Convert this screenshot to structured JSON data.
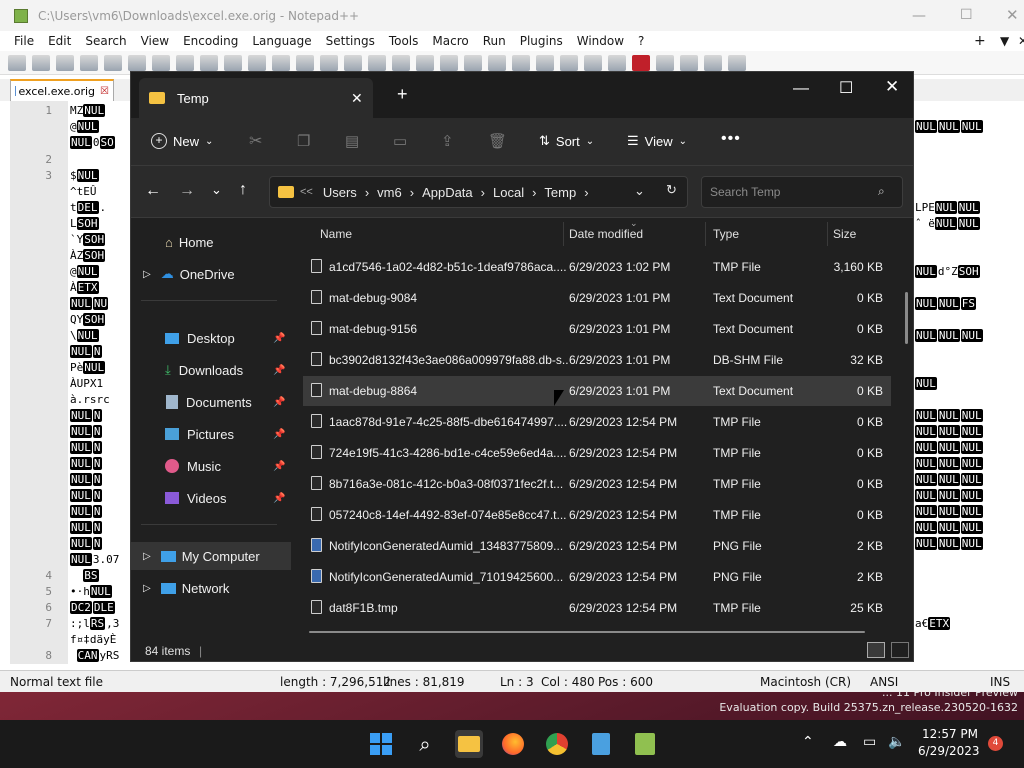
{
  "notepad": {
    "title": "C:\\Users\\vm6\\Downloads\\excel.exe.orig - Notepad++",
    "menu": [
      "File",
      "Edit",
      "Search",
      "View",
      "Encoding",
      "Language",
      "Settings",
      "Tools",
      "Macro",
      "Run",
      "Plugins",
      "Window",
      "?"
    ],
    "tab_label": "excel.exe.orig",
    "line_numbers": [
      "1",
      "2",
      "3",
      "4",
      "5",
      "6",
      "7",
      "8"
    ],
    "status": {
      "type": "Normal text file",
      "length": "length : 7,296,512",
      "lines": "lines : 81,819",
      "ln": "Ln : 3",
      "col": "Col : 480",
      "pos": "Pos : 600",
      "eol": "Macintosh (CR)",
      "encoding": "ANSI",
      "mode": "INS"
    }
  },
  "explorer": {
    "tab_title": "Temp",
    "toolbar": {
      "new_label": "New",
      "sort_label": "Sort",
      "view_label": "View"
    },
    "breadcrumb": [
      "<<",
      "Users",
      "vm6",
      "AppData",
      "Local",
      "Temp"
    ],
    "search_placeholder": "Search Temp",
    "nav_items": [
      {
        "label": "Home"
      },
      {
        "label": "OneDrive"
      },
      {
        "label": "Desktop"
      },
      {
        "label": "Downloads"
      },
      {
        "label": "Documents"
      },
      {
        "label": "Pictures"
      },
      {
        "label": "Music"
      },
      {
        "label": "Videos"
      },
      {
        "label": "My Computer"
      },
      {
        "label": "Network"
      }
    ],
    "columns": [
      "Name",
      "Date modified",
      "Type",
      "Size"
    ],
    "files": [
      {
        "name": "a1cd7546-1a02-4d82-b51c-1deaf9786aca....",
        "date": "6/29/2023 1:02 PM",
        "type": "TMP File",
        "size": "3,160 KB"
      },
      {
        "name": "mat-debug-9084",
        "date": "6/29/2023 1:01 PM",
        "type": "Text Document",
        "size": "0 KB"
      },
      {
        "name": "mat-debug-9156",
        "date": "6/29/2023 1:01 PM",
        "type": "Text Document",
        "size": "0 KB"
      },
      {
        "name": "bc3902d8132f43e3ae086a009979fa88.db-s...",
        "date": "6/29/2023 1:01 PM",
        "type": "DB-SHM File",
        "size": "32 KB"
      },
      {
        "name": "mat-debug-8864",
        "date": "6/29/2023 1:01 PM",
        "type": "Text Document",
        "size": "0 KB"
      },
      {
        "name": "1aac878d-91e7-4c25-88f5-dbe616474997....",
        "date": "6/29/2023 12:54 PM",
        "type": "TMP File",
        "size": "0 KB"
      },
      {
        "name": "724e19f5-41c3-4286-bd1e-c4ce59e6ed4a....",
        "date": "6/29/2023 12:54 PM",
        "type": "TMP File",
        "size": "0 KB"
      },
      {
        "name": "8b716a3e-081c-412c-b0a3-08f0371fec2f.t...",
        "date": "6/29/2023 12:54 PM",
        "type": "TMP File",
        "size": "0 KB"
      },
      {
        "name": "057240c8-14ef-4492-83ef-074e85e8cc47.t...",
        "date": "6/29/2023 12:54 PM",
        "type": "TMP File",
        "size": "0 KB"
      },
      {
        "name": "NotifyIconGeneratedAumid_13483775809...",
        "date": "6/29/2023 12:54 PM",
        "type": "PNG File",
        "size": "2 KB"
      },
      {
        "name": "NotifyIconGeneratedAumid_71019425600...",
        "date": "6/29/2023 12:54 PM",
        "type": "PNG File",
        "size": "2 KB"
      },
      {
        "name": "dat8F1B.tmp",
        "date": "6/29/2023 12:54 PM",
        "type": "TMP File",
        "size": "25 KB"
      }
    ],
    "item_count": "84 items"
  },
  "watermark": {
    "line1": "... 11 Pro Insider Preview",
    "line2": "Evaluation copy. Build 25375.zn_release.230520-1632"
  },
  "taskbar": {
    "time": "12:57 PM",
    "date": "6/29/2023",
    "notification_count": "4"
  }
}
